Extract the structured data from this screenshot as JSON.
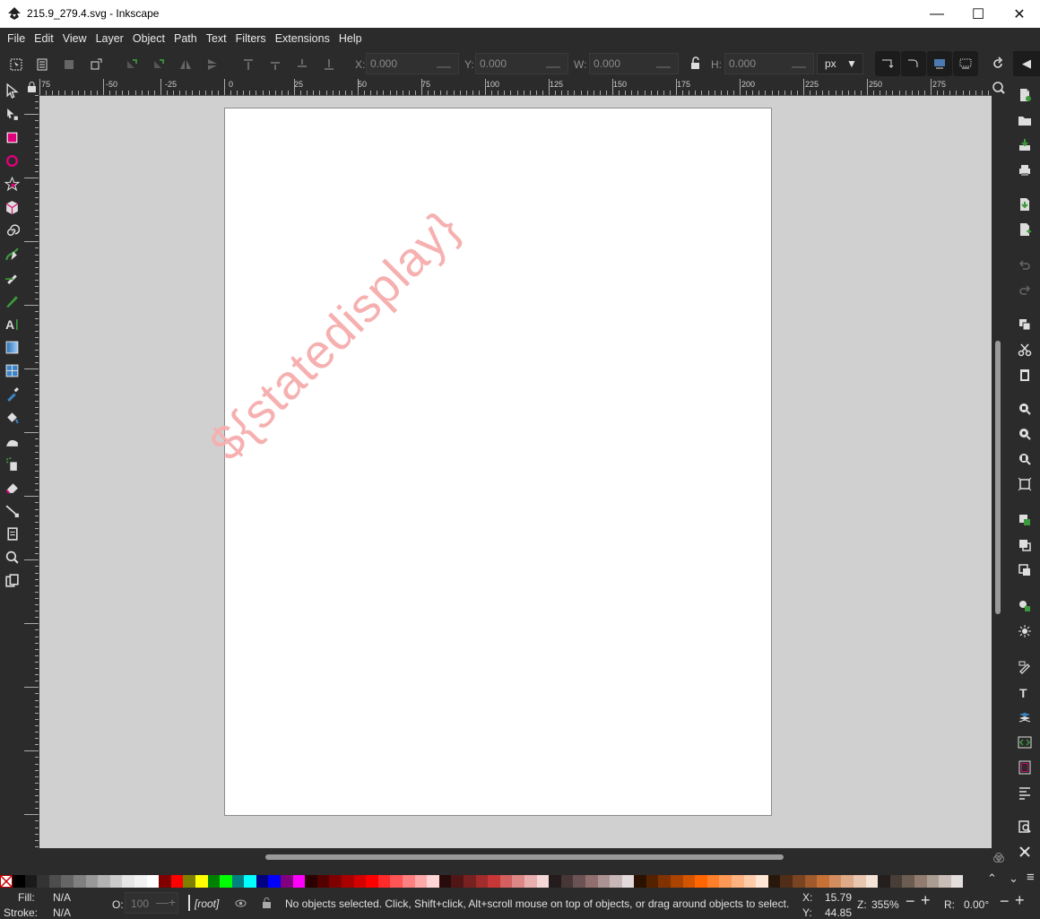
{
  "window": {
    "title": "215.9_279.4.svg - Inkscape",
    "minimize": "—",
    "maximize": "☐",
    "close": "✕"
  },
  "menu": [
    "File",
    "Edit",
    "View",
    "Layer",
    "Object",
    "Path",
    "Text",
    "Filters",
    "Extensions",
    "Help"
  ],
  "toolbar": {
    "x_label": "X:",
    "x_value": "0.000",
    "y_label": "Y:",
    "y_value": "0.000",
    "w_label": "W:",
    "w_value": "0.000",
    "h_label": "H:",
    "h_value": "0.000",
    "unit": "px",
    "minus": "—",
    "plus": "+"
  },
  "rulers": {
    "horizontal": [
      "75",
      "-50",
      "-25",
      "0",
      "25",
      "50",
      "75",
      "100",
      "125",
      "150",
      "175",
      "200",
      "225",
      "250",
      "275"
    ]
  },
  "canvas": {
    "watermark": "${statedisplay}",
    "watermark_color": "#f6b0b0",
    "background": "#d0d0d0"
  },
  "palette_colors": [
    "#000000",
    "#1a1a1a",
    "#333333",
    "#4d4d4d",
    "#666666",
    "#808080",
    "#999999",
    "#b3b3b3",
    "#cccccc",
    "#e6e6e6",
    "#f2f2f2",
    "#ffffff",
    "#800000",
    "#ff0000",
    "#808000",
    "#ffff00",
    "#008000",
    "#00ff00",
    "#008080",
    "#00ffff",
    "#000080",
    "#0000ff",
    "#800080",
    "#ff00ff",
    "#2b0000",
    "#550000",
    "#800000",
    "#aa0000",
    "#d40000",
    "#ff0000",
    "#ff2a2a",
    "#ff5555",
    "#ff8080",
    "#ffaaaa",
    "#ffd5d5",
    "#280b0b",
    "#501616",
    "#782121",
    "#a02c2c",
    "#c83737",
    "#d35f5f",
    "#de8787",
    "#e9afaf",
    "#f4d7d7",
    "#241c1c",
    "#483737",
    "#6c5353",
    "#916f6f",
    "#ac9393",
    "#c8b7b7",
    "#e3dbdb",
    "#2b1100",
    "#552200",
    "#803300",
    "#aa4400",
    "#d45500",
    "#ff6600",
    "#ff7f2a",
    "#ff9955",
    "#ffb380",
    "#ffccaa",
    "#ffe6d5",
    "#28170b",
    "#502d16",
    "#784421",
    "#a05a2c",
    "#c87137",
    "#d38d5f",
    "#deaa87",
    "#e9c6af",
    "#f4e3d7",
    "#241f1c",
    "#483e37",
    "#6c5d53",
    "#917c6f",
    "#ac9d93",
    "#c8beb7",
    "#e3dedb"
  ],
  "status": {
    "fill_label": "Fill:",
    "fill_value": "N/A",
    "stroke_label": "Stroke:",
    "stroke_value": "N/A",
    "opacity_label": "O:",
    "opacity_value": "100",
    "layer": "[root]",
    "message": "No objects selected. Click, Shift+click, Alt+scroll mouse on top of objects, or drag around objects to select.",
    "x_label": "X:",
    "x_value": "15.79",
    "y_label": "Y:",
    "y_value": "44.85",
    "zoom_label": "Z:",
    "zoom_value": "355%",
    "rotate_label": "R:",
    "rotate_value": "0.00°"
  }
}
